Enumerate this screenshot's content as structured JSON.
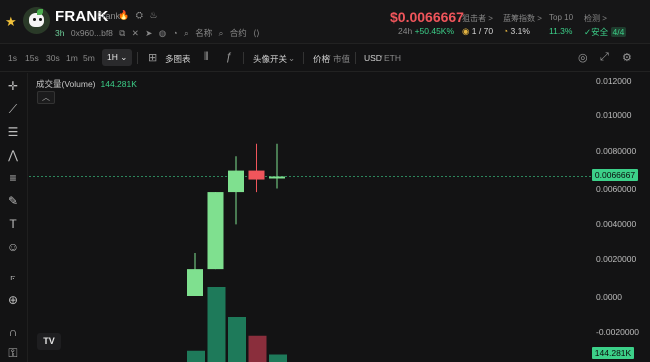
{
  "token": {
    "symbol": "FRANK",
    "name": "Frank",
    "flags": "🔥 ⛭ ♨",
    "age": "3h",
    "address": "0x960...bf8",
    "meta_items": [
      "名称",
      "合约"
    ]
  },
  "price": {
    "value": "$0.0066667",
    "change_prefix": "24h",
    "change": "+50.45K%"
  },
  "stats": [
    {
      "label": "狙击者 >",
      "value": "1 / 70",
      "color": "#d5d5d5"
    },
    {
      "label": "蓝筹指数 >",
      "value": "3.1%",
      "color": "#d5d5d5"
    },
    {
      "label": "Top 10",
      "value": "11.3%",
      "color": "#3cd089"
    },
    {
      "label": "检测 >",
      "value": "安全",
      "extra": "4/4",
      "color": "#3cd089"
    }
  ],
  "toolbar": {
    "intervals": [
      "1s",
      "15s",
      "30s",
      "1m",
      "5m",
      "1H"
    ],
    "selected_interval": "1H",
    "multi_chart": "多图表",
    "headlines": "头像开关",
    "price_label": "价格",
    "mcap_label": "市值",
    "currency": "USD",
    "alt_currency": "ETH"
  },
  "chart": {
    "volume_label": "成交量(Volume)",
    "volume_value": "144.281K",
    "y_ticks": [
      "0.012000",
      "0.010000",
      "0.0080000",
      "0.0060000",
      "0.0040000",
      "0.0020000",
      "0.0000",
      "-0.0020000"
    ],
    "current_price_tag": "0.0066667",
    "volume_tag": "144.281K",
    "logo": "TV"
  },
  "chart_data": {
    "type": "candlestick",
    "candles": [
      {
        "open": 0.0,
        "high": 0.0024,
        "low": 0.0,
        "close": 0.0015,
        "color": "up"
      },
      {
        "open": 0.0015,
        "high": 0.0058,
        "low": 0.0015,
        "close": 0.0058,
        "color": "up"
      },
      {
        "open": 0.0058,
        "high": 0.0078,
        "low": 0.004,
        "close": 0.007,
        "color": "up"
      },
      {
        "open": 0.007,
        "high": 0.0085,
        "low": 0.0058,
        "close": 0.0065,
        "color": "down"
      },
      {
        "open": 0.00667,
        "high": 0.0085,
        "low": 0.006,
        "close": 0.00667,
        "color": "up"
      }
    ],
    "volumes": [
      {
        "value": 0.15,
        "color": "up"
      },
      {
        "value": 1.0,
        "color": "up"
      },
      {
        "value": 0.6,
        "color": "up"
      },
      {
        "value": 0.35,
        "color": "down"
      },
      {
        "value": 0.1,
        "color": "up"
      }
    ],
    "ylim": [
      -0.002,
      0.012
    ],
    "current_price": 0.0066667
  },
  "colors": {
    "up": "#7fe08f",
    "down": "#f0555b",
    "vol_up": "#1e7a5a",
    "vol_down": "#8a2e3c"
  }
}
